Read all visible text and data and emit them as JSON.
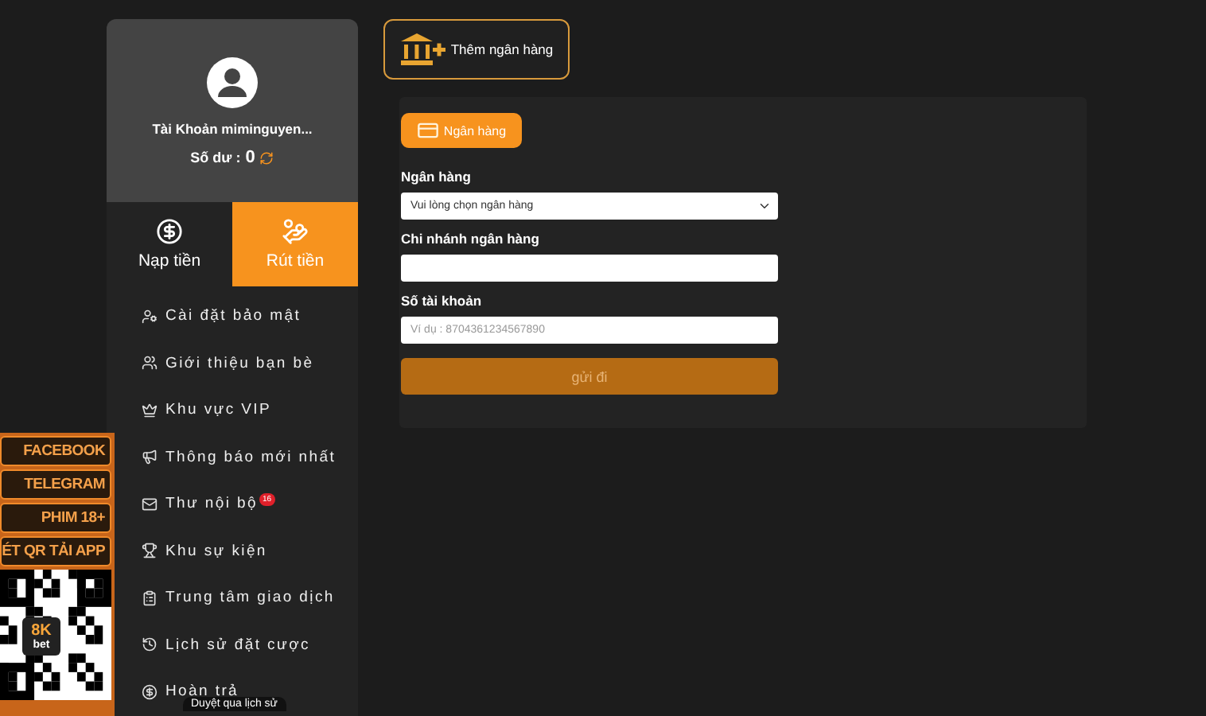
{
  "profile": {
    "account": "Tài Khoản miminguyen...",
    "balance_label": "Số dư :",
    "balance": "0"
  },
  "tabs": [
    {
      "label": "Nạp tiền",
      "selected": false
    },
    {
      "label": "Rút tiền",
      "selected": true
    }
  ],
  "menu": [
    {
      "label": "Cài đặt bảo mật"
    },
    {
      "label": "Giới thiệu bạn bè"
    },
    {
      "label": "Khu vực VIP"
    },
    {
      "label": "Thông báo mới nhất"
    },
    {
      "label": "Thư nội bộ",
      "badge": "16"
    },
    {
      "label": "Khu sự kiện"
    },
    {
      "label": "Trung tâm giao dịch"
    },
    {
      "label": "Lịch sử đặt cược"
    },
    {
      "label": "Hoàn trả"
    }
  ],
  "add_bank_button": "Thêm ngân hàng",
  "form": {
    "tab": "Ngân hàng",
    "fields": [
      {
        "kind": "select",
        "label": "Ngân hàng",
        "placeholder": "Vui lòng chọn ngân hàng"
      },
      {
        "kind": "input",
        "label": "Chi nhánh ngân hàng"
      },
      {
        "kind": "input",
        "label": "Số tài khoản",
        "placeholder": "Ví dụ : 8704361234567890"
      }
    ],
    "submit": "gửi đi"
  },
  "float_links": [
    "FACEBOOK",
    "TELEGRAM",
    "PHIM 18+",
    "ÉT QR TẢI APP"
  ],
  "qr_logo": [
    "8K",
    "bet"
  ],
  "tooltip": "Duyệt qua lịch sử"
}
